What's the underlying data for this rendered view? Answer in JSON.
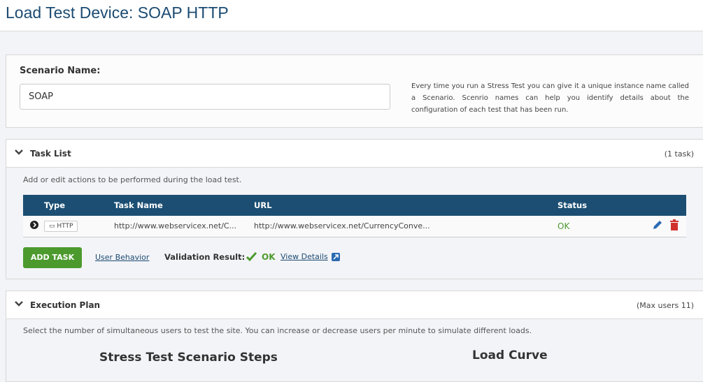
{
  "page": {
    "title": "Load Test Device: SOAP HTTP"
  },
  "scenario": {
    "label": "Scenario Name:",
    "value": "SOAP",
    "help": "Every time you run a Stress Test you can give it a unique instance name called a Scenario. Scenrio names can help you identify details about the configuration of each test that has been run."
  },
  "task_list": {
    "title": "Task List",
    "count": "(1 task)",
    "description": "Add or edit actions to be performed during the load test.",
    "columns": [
      "Type",
      "Task Name",
      "URL",
      "Status"
    ],
    "rows": [
      {
        "type": "HTTP",
        "task_name": "http://www.webservicex.net/C...",
        "url": "http://www.webservicex.net/CurrencyConve...",
        "status": "OK"
      }
    ],
    "add_task": "ADD TASK",
    "user_behavior": "User Behavior",
    "validation_label": "Validation Result:",
    "validation_value": "OK",
    "view_details": "View Details"
  },
  "execution_plan": {
    "title": "Execution Plan",
    "max_users": "(Max users 11)",
    "description": "Select the number of simultaneous users to test the site. You can increase or decrease users per minute to simulate different loads.",
    "steps_title": "Stress Test Scenario Steps",
    "curve_title": "Load Curve"
  },
  "colors": {
    "header": "#1b4e72",
    "ok": "#4c9a2e",
    "delete": "#d0312d"
  }
}
